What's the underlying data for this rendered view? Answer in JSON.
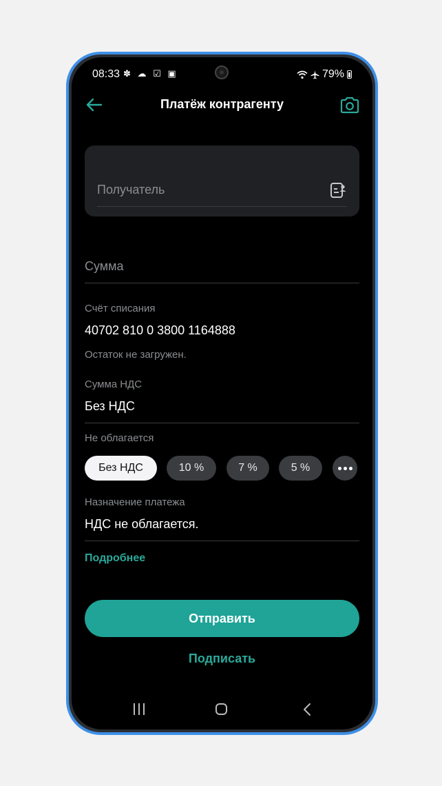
{
  "status_bar": {
    "time": "08:33",
    "notification_icons": "✽ ☁ ☑ ▣",
    "battery": "79%"
  },
  "header": {
    "title": "Платёж контрагенту",
    "back_icon": "arrow-left-icon",
    "camera_icon": "camera-icon"
  },
  "form": {
    "recipient_placeholder": "Получатель",
    "amount_placeholder": "Сумма",
    "account": {
      "label": "Счёт списания",
      "value": "40702 810 0 3800 1164888",
      "hint": "Остаток не загружен."
    },
    "vat": {
      "label": "Сумма НДС",
      "value": "Без НДС",
      "note": "Не облагается",
      "chips": [
        "Без НДС",
        "10 %",
        "7 %",
        "5 %"
      ],
      "selected": "Без НДС"
    },
    "purpose": {
      "label": "Назначение платежа",
      "value": "НДС не облагается."
    },
    "more_link": "Подробнее"
  },
  "actions": {
    "send": "Отправить",
    "sign": "Подписать"
  },
  "colors": {
    "accent": "#1fa497",
    "frame": "#3f8fe6",
    "background": "#000000"
  }
}
